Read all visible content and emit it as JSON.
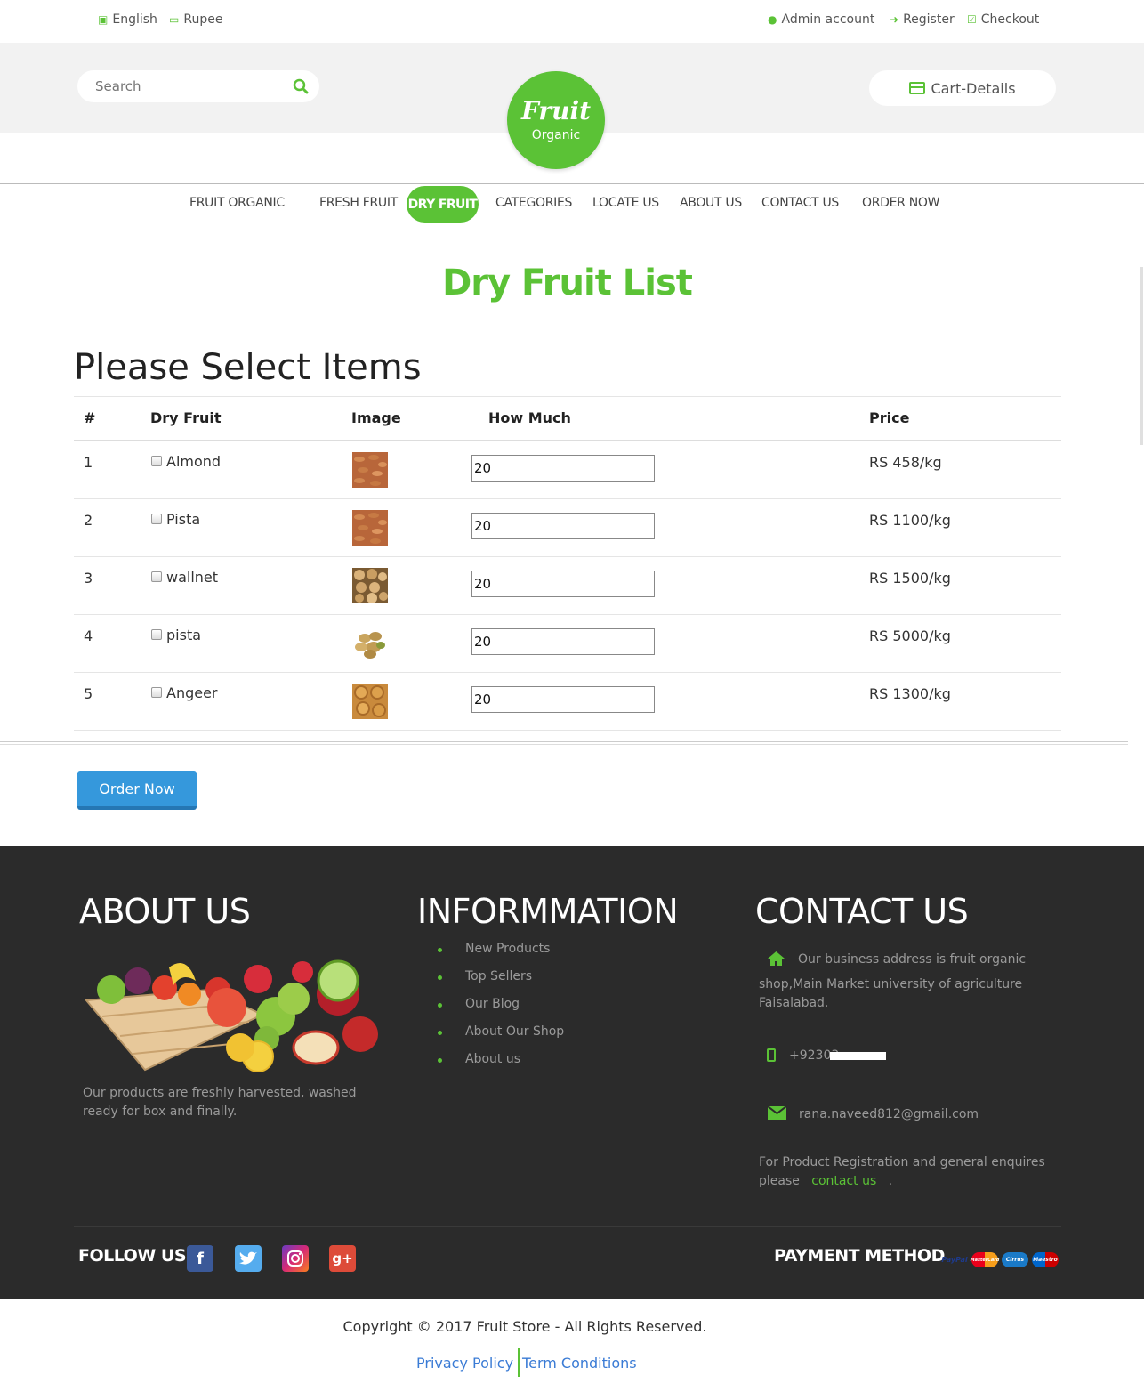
{
  "topbar": {
    "language": "English",
    "currency": "Rupee",
    "admin": "Admin account",
    "register": "Register",
    "checkout": "Checkout"
  },
  "search": {
    "placeholder": "Search"
  },
  "logo": {
    "title": "Fruit",
    "subtitle": "Organic"
  },
  "cart": {
    "label": "Cart-Details"
  },
  "nav": {
    "items": [
      "FRUIT ORGANIC",
      "FRESH FRUIT",
      "DRY FRUIT",
      "CATEGORIES",
      "LOCATE US",
      "ABOUT US",
      "CONTACT US",
      "ORDER NOW"
    ],
    "active": "DRY FRUIT"
  },
  "page_title": "Dry Fruit List",
  "section_title": "Please Select Items",
  "table": {
    "headers": [
      "#",
      "Dry Fruit",
      "Image",
      "How Much",
      "Price"
    ],
    "rows": [
      {
        "num": "1",
        "name": "Almond",
        "qty": "20",
        "price": "RS 458/kg"
      },
      {
        "num": "2",
        "name": "Pista",
        "qty": "20",
        "price": "RS 1100/kg"
      },
      {
        "num": "3",
        "name": "wallnet",
        "qty": "20",
        "price": "RS 1500/kg"
      },
      {
        "num": "4",
        "name": "pista",
        "qty": "20",
        "price": "RS 5000/kg"
      },
      {
        "num": "5",
        "name": "Angeer",
        "qty": "20",
        "price": "RS 1300/kg"
      }
    ]
  },
  "order_button": "Order Now",
  "footer": {
    "about": {
      "title": "ABOUT US",
      "text": "Our products are freshly harvested, washed ready for box and finally."
    },
    "info": {
      "title": "INFORMMATION",
      "links": [
        "New Products",
        "Top Sellers",
        "Our Blog",
        "About Our Shop",
        "About us"
      ]
    },
    "contact": {
      "title": "CONTACT US",
      "address_line1": "Our business address is fruit organic",
      "address_line2": "shop,Main Market university of agriculture Faisalabad.",
      "phone": "+92303",
      "email": "rana.naveed812@gmail.com",
      "note": "For Product Registration and general enquires please",
      "note_link": "contact us",
      "note_end": "."
    },
    "follow": "FOLLOW US",
    "payment": "PAYMENT METHOD",
    "cards": [
      "PayPal",
      "MasterCard",
      "Cirrus",
      "Maestro"
    ]
  },
  "copyright": "Copyright © 2017 Fruit Store - All Rights Reserved.",
  "bottom_links": {
    "privacy": "Privacy Policy",
    "terms": "Term Conditions"
  },
  "colors": {
    "accent": "#5bc236",
    "button": "#3598dc",
    "footer": "#2b2b2b"
  }
}
